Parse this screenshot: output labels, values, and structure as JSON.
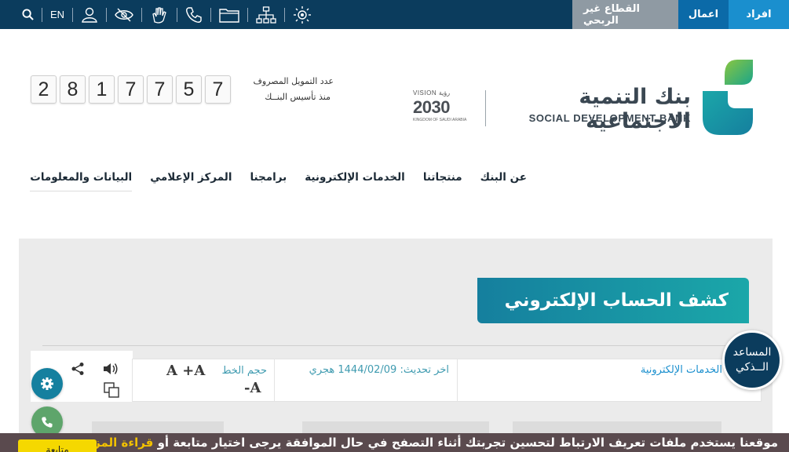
{
  "topbar": {
    "segments": [
      "افراد",
      "اعمال",
      "القطاع غير الربحي"
    ],
    "lang": "EN",
    "tools": [
      "search-icon",
      "user-icon",
      "eye-slash-icon",
      "sign-language-icon",
      "phone-icon",
      "folder-icon",
      "sitemap-icon",
      "sun-icon"
    ]
  },
  "brand": {
    "name_ar": "بنك التنمية الاجتماعية",
    "name_en": "SOCIAL DEVELOPMENT BANK",
    "vision_top": "VISION رؤية",
    "vision_year": "2030",
    "vision_bottom": "KINGDOM OF SAUDI ARABIA"
  },
  "counter": {
    "label1": "عدد التمويل المصروف",
    "label2": "منذ تأسيس البنــك",
    "digits": [
      "2",
      "8",
      "1",
      "7",
      "7",
      "5",
      "7"
    ]
  },
  "nav": [
    "عن البنك",
    "منتجاتنا",
    "الخدمات الإلكترونية",
    "برامجنا",
    "المركز الإعلامي",
    "البيانات والمعلومات"
  ],
  "page": {
    "title": "كشف الحساب الإلكتروني",
    "breadcrumb": "الخدمات الإلكترونية",
    "updated": "اخر تحديث: 1444/02/09 هجري",
    "font_size_label": "حجم الخط",
    "font_increase": "A +A",
    "font_decrease": "-A"
  },
  "assistant": {
    "line1": "المساعد",
    "line2": "الــذكي"
  },
  "cookie": {
    "text": "موقعنا يستخدم ملفات تعريف الارتباط لتحسين تجربتك أثناء التصفح في حال الموافقة يرجى اختيار متابعة أو",
    "more": "قراءة المزيد",
    "button": "متابعة"
  },
  "colors": {
    "navy": "#0b3c5d",
    "teal": "#1ba7a9",
    "blue": "#1a8fce",
    "green": "#5ea56b"
  }
}
